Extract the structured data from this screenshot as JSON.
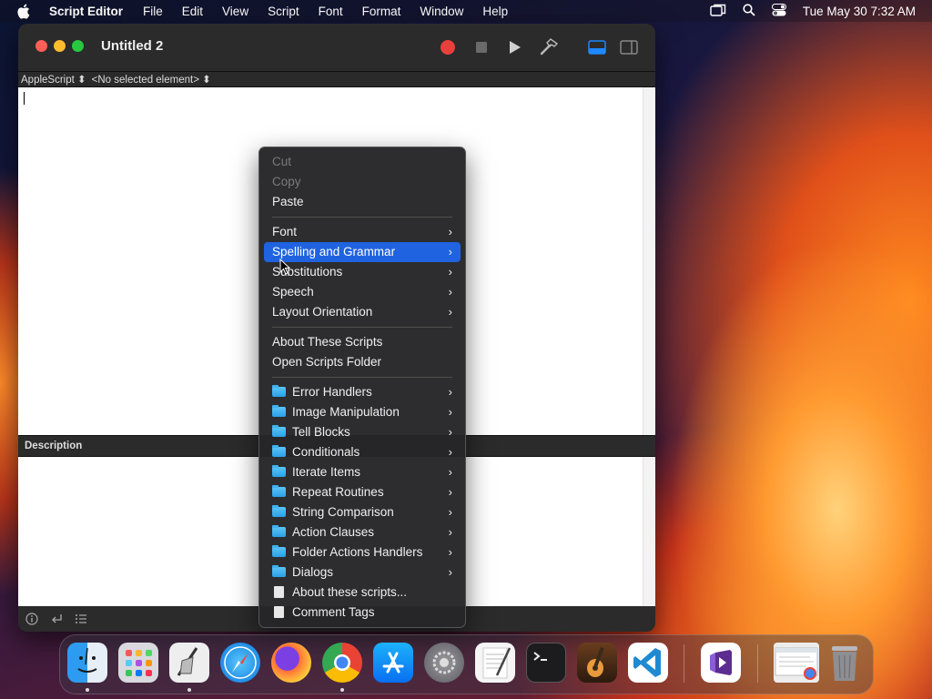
{
  "menubar": {
    "app_name": "Script Editor",
    "items": [
      "File",
      "Edit",
      "View",
      "Script",
      "Font",
      "Format",
      "Window",
      "Help"
    ],
    "clock": "Tue May 30  7:32 AM"
  },
  "window": {
    "title": "Untitled 2",
    "language_selector": "AppleScript ⬍",
    "element_selector": "<No selected element> ⬍",
    "description_label": "Description"
  },
  "context_menu": {
    "group1": [
      {
        "label": "Cut",
        "disabled": true
      },
      {
        "label": "Copy",
        "disabled": true
      },
      {
        "label": "Paste",
        "disabled": false
      }
    ],
    "group2": [
      {
        "label": "Font",
        "submenu": true
      },
      {
        "label": "Spelling and Grammar",
        "submenu": true,
        "highlighted": true
      },
      {
        "label": "Substitutions",
        "submenu": true
      },
      {
        "label": "Speech",
        "submenu": true
      },
      {
        "label": "Layout Orientation",
        "submenu": true
      }
    ],
    "group3": [
      {
        "label": "About These Scripts"
      },
      {
        "label": "Open Scripts Folder"
      }
    ],
    "group4": [
      {
        "label": "Error Handlers",
        "icon": "folder-icon",
        "submenu": true
      },
      {
        "label": "Image Manipulation",
        "icon": "folder-icon",
        "submenu": true
      },
      {
        "label": "Tell Blocks",
        "icon": "folder-icon",
        "submenu": true
      },
      {
        "label": "Conditionals",
        "icon": "folder-icon",
        "submenu": true
      },
      {
        "label": "Iterate Items",
        "icon": "folder-icon",
        "submenu": true
      },
      {
        "label": "Repeat Routines",
        "icon": "folder-icon",
        "submenu": true
      },
      {
        "label": "String Comparison",
        "icon": "folder-icon",
        "submenu": true
      },
      {
        "label": "Action Clauses",
        "icon": "folder-icon",
        "submenu": true
      },
      {
        "label": "Folder Actions Handlers",
        "icon": "folder-icon",
        "submenu": true
      },
      {
        "label": "Dialogs",
        "icon": "folder-icon",
        "submenu": true
      },
      {
        "label": "About these scripts...",
        "icon": "document-icon"
      },
      {
        "label": "Comment Tags",
        "icon": "document-icon"
      }
    ],
    "chevron": "›"
  },
  "dock": {
    "apps": [
      "Finder",
      "Launchpad",
      "Script Editor",
      "Safari",
      "Firefox",
      "Chrome",
      "App Store",
      "System Settings",
      "TextEdit",
      "Terminal",
      "GarageBand",
      "VS Code",
      "Visual Studio",
      "Chrome Window",
      "Trash"
    ]
  },
  "colors": {
    "accent": "#1f63e0",
    "record": "#e8413c"
  }
}
